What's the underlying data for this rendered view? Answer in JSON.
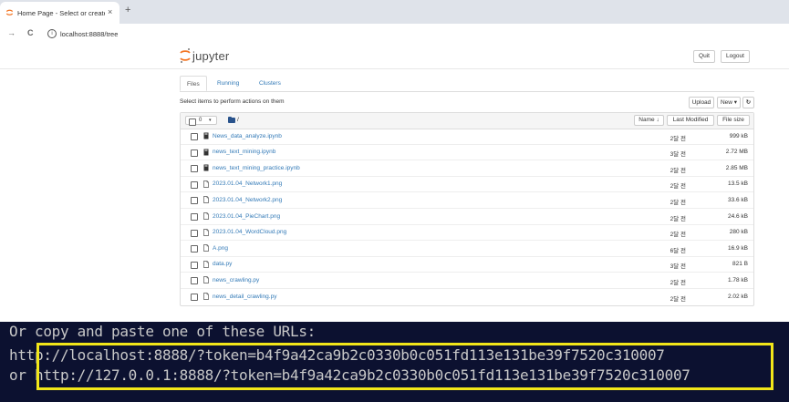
{
  "browser": {
    "tab_title": "Home Page - Select or create",
    "tab_close": "×",
    "new_tab": "+",
    "back": "→",
    "reload": "C",
    "info": "i",
    "url": "localhost:8888/tree"
  },
  "jupyter": {
    "logo_text": "jupyter",
    "quit_label": "Quit",
    "logout_label": "Logout",
    "tabs": [
      {
        "label": "Files",
        "active": true
      },
      {
        "label": "Running",
        "active": false
      },
      {
        "label": "Clusters",
        "active": false
      }
    ],
    "hint": "Select items to perform actions on them",
    "upload_label": "Upload",
    "new_label": "New ▾",
    "refresh_label": "↻",
    "selected_count": "0",
    "select_caret": "▾",
    "breadcrumb_sep": "/",
    "col_name": "Name ↓",
    "col_modified": "Last Modified",
    "col_size": "File size",
    "files": [
      {
        "name": "News_data_analyze.ipynb",
        "type": "notebook",
        "modified": "2달 전",
        "size": "999 kB"
      },
      {
        "name": "news_text_mining.ipynb",
        "type": "notebook",
        "modified": "3달 전",
        "size": "2.72 MB"
      },
      {
        "name": "news_text_mining_practice.ipynb",
        "type": "notebook",
        "modified": "2달 전",
        "size": "2.85 MB"
      },
      {
        "name": "2023.01.04_Network1.png",
        "type": "file",
        "modified": "2달 전",
        "size": "13.5 kB"
      },
      {
        "name": "2023.01.04_Network2.png",
        "type": "file",
        "modified": "2달 전",
        "size": "33.6 kB"
      },
      {
        "name": "2023.01.04_PieChart.png",
        "type": "file",
        "modified": "2달 전",
        "size": "24.6 kB"
      },
      {
        "name": "2023.01.04_WordCloud.png",
        "type": "file",
        "modified": "2달 전",
        "size": "280 kB"
      },
      {
        "name": "A.png",
        "type": "file",
        "modified": "6달 전",
        "size": "16.9 kB"
      },
      {
        "name": "data.py",
        "type": "file",
        "modified": "3달 전",
        "size": "821 B"
      },
      {
        "name": "news_crawling.py",
        "type": "file",
        "modified": "2달 전",
        "size": "1.78 kB"
      },
      {
        "name": "news_detail_crawling.py",
        "type": "file",
        "modified": "2달 전",
        "size": "2.02 kB"
      }
    ]
  },
  "terminal": {
    "line1": "Or copy and paste one of these URLs:",
    "line2": "    http://localhost:8888/?token=b4f9a42ca9b2c0330b0c051fd113e131be39f7520c310007",
    "line3": " or http://127.0.0.1:8888/?token=b4f9a42ca9b2c0330b0c051fd113e131be39f7520c310007"
  },
  "colors": {
    "link": "#337ab7",
    "terminal_bg": "#0c1130",
    "highlight": "#f2e619",
    "jupyter_orange": "#f37726"
  }
}
